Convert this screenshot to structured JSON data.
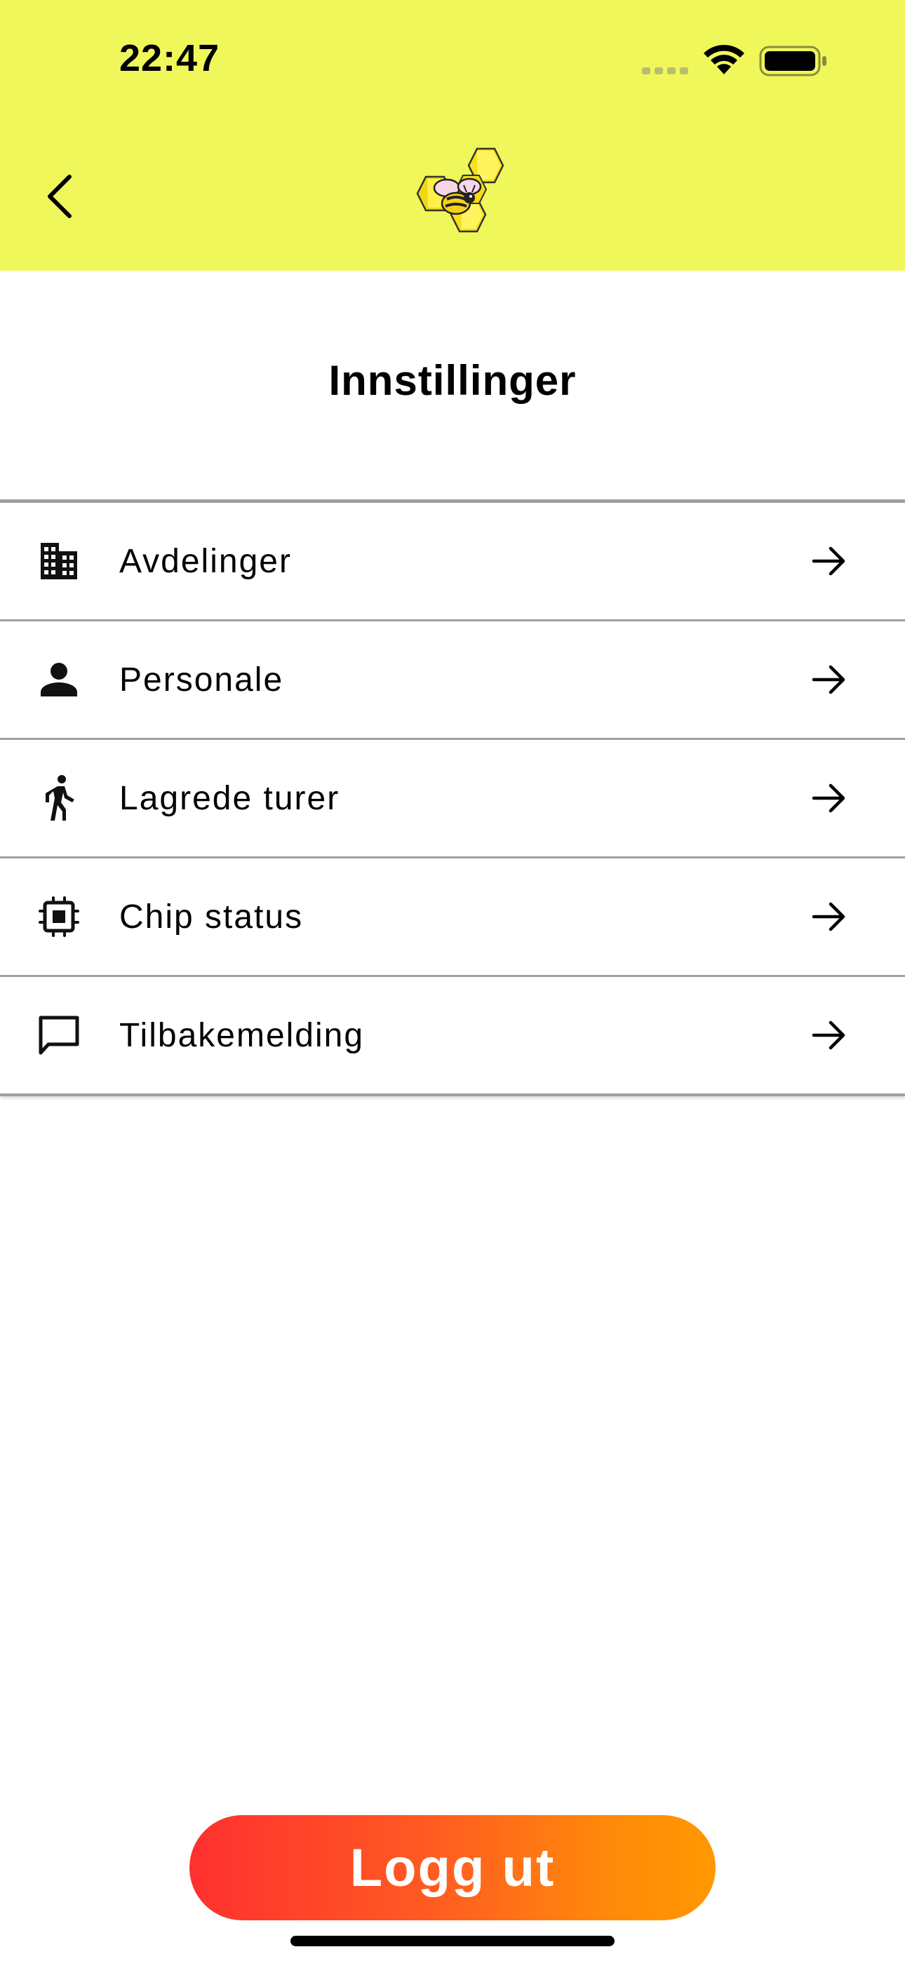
{
  "status_bar": {
    "time": "22:47"
  },
  "header": {
    "background": "#f0f75a",
    "back_icon": "chevron-left-icon",
    "logo": "honeycomb-bee-logo"
  },
  "page": {
    "title": "Innstillinger"
  },
  "menu": {
    "items": [
      {
        "label": "Avdelinger",
        "icon": "building-icon"
      },
      {
        "label": "Personale",
        "icon": "person-icon"
      },
      {
        "label": "Lagrede turer",
        "icon": "walking-icon"
      },
      {
        "label": "Chip status",
        "icon": "chip-icon"
      },
      {
        "label": "Tilbakemelding",
        "icon": "message-icon"
      }
    ],
    "trailing_icon": "arrow-right-icon"
  },
  "logout": {
    "label": "Logg ut",
    "gradient": [
      "#ff3030",
      "#ff9800"
    ]
  }
}
